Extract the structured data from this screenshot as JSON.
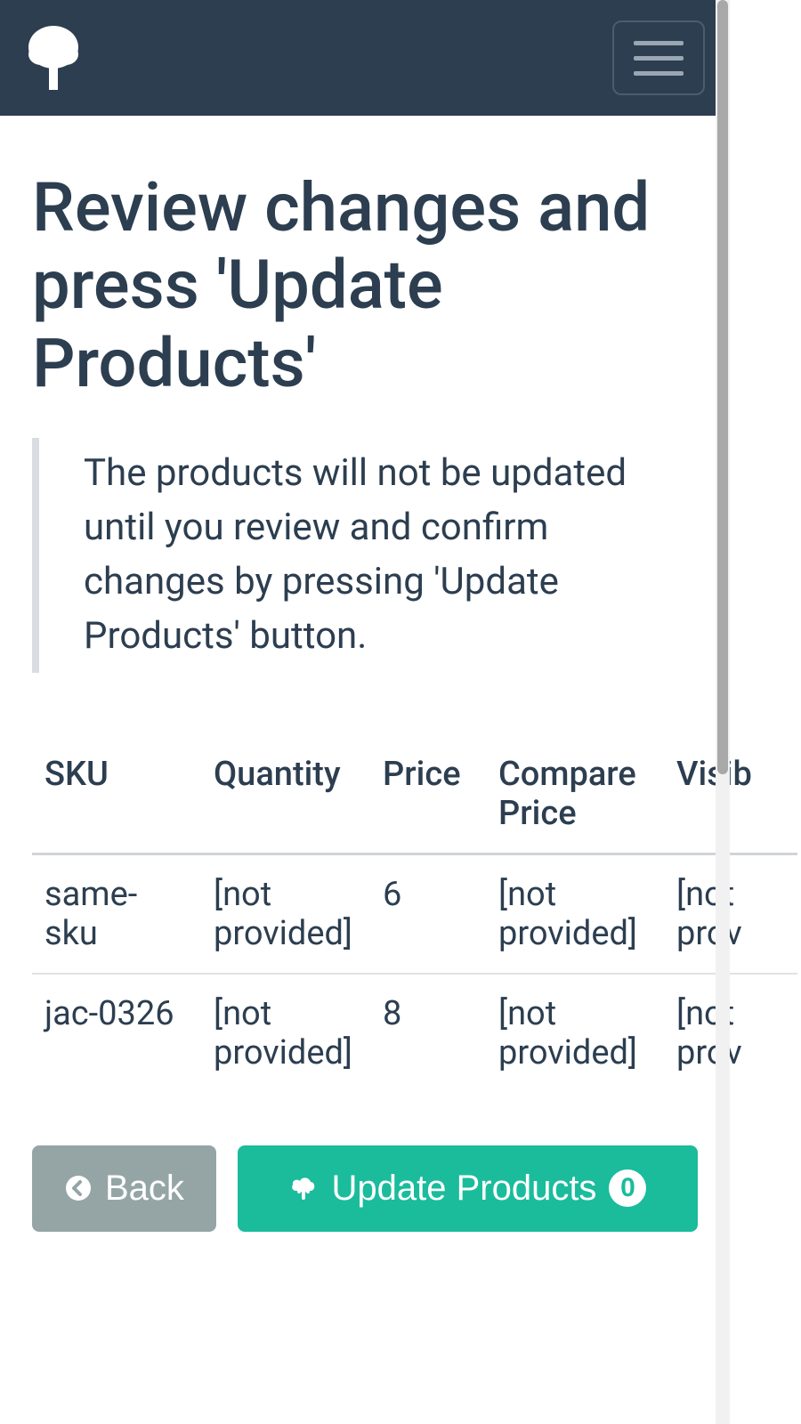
{
  "header": {
    "title": "Review changes and press 'Update Products'",
    "info": "The products will not be updated until you review and confirm changes by pressing 'Update Products' button."
  },
  "table": {
    "headers": {
      "sku": "SKU",
      "quantity": "Quantity",
      "price": "Price",
      "compare_price": "Compare Price",
      "visible": "Visib"
    },
    "rows": [
      {
        "sku": "same-sku",
        "quantity": "[not provided]",
        "price": "6",
        "compare_price": "[not provided]",
        "visible": "[not prov"
      },
      {
        "sku": "jac-0326",
        "quantity": "[not provided]",
        "price": "8",
        "compare_price": "[not provided]",
        "visible": "[not prov"
      }
    ]
  },
  "buttons": {
    "back": "Back",
    "update": "Update Products",
    "update_count": "0"
  }
}
